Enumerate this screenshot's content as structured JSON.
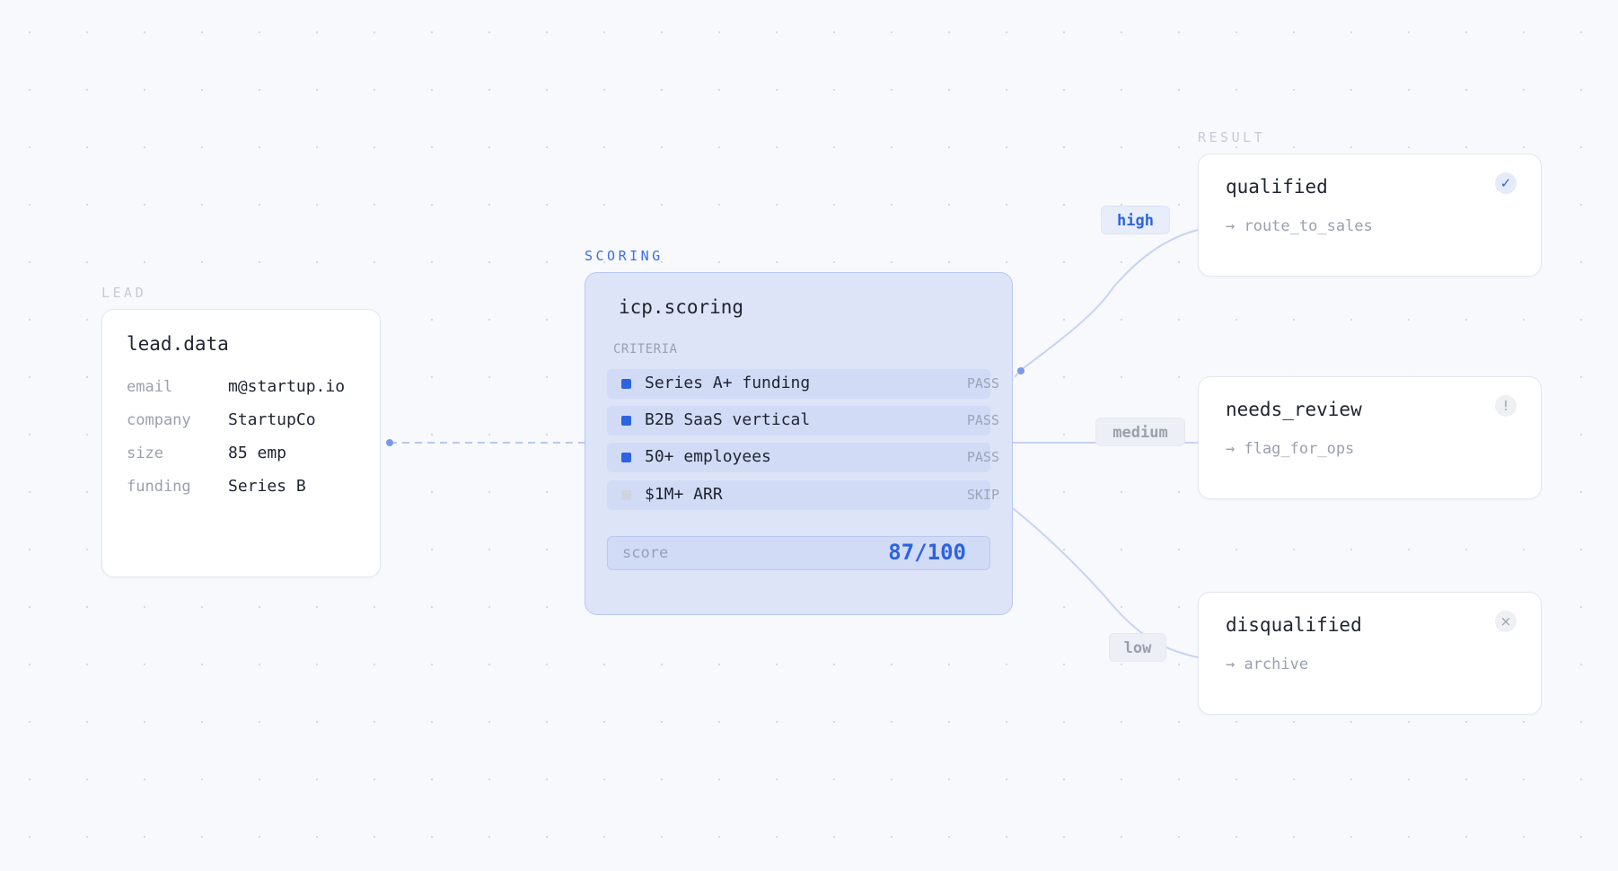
{
  "lead": {
    "section_label": "LEAD",
    "title": "lead.data",
    "fields": [
      {
        "key": "email",
        "value": "m@startup.io"
      },
      {
        "key": "company",
        "value": "StartupCo"
      },
      {
        "key": "size",
        "value": "85 emp"
      },
      {
        "key": "funding",
        "value": "Series B"
      }
    ]
  },
  "scoring": {
    "section_label": "SCORING",
    "title": "icp.scoring",
    "criteria_label": "CRITERIA",
    "criteria": [
      {
        "name": "Series A+ funding",
        "status": "PASS"
      },
      {
        "name": "B2B SaaS vertical",
        "status": "PASS"
      },
      {
        "name": "50+ employees",
        "status": "PASS"
      },
      {
        "name": "$1M+ ARR",
        "status": "SKIP"
      }
    ],
    "score_label": "score",
    "score_value": "87/100"
  },
  "edges": {
    "high": "high",
    "medium": "medium",
    "low": "low"
  },
  "result": {
    "section_label": "RESULT",
    "outcomes": [
      {
        "title": "qualified",
        "action": "→ route_to_sales",
        "icon": "✓"
      },
      {
        "title": "needs_review",
        "action": "→ flag_for_ops",
        "icon": "!"
      },
      {
        "title": "disqualified",
        "action": "→ archive",
        "icon": "×"
      }
    ]
  },
  "colors": {
    "accent": "#2e63e0",
    "scoring_fill": "#dde4f8",
    "background": "#f8f9fc"
  }
}
